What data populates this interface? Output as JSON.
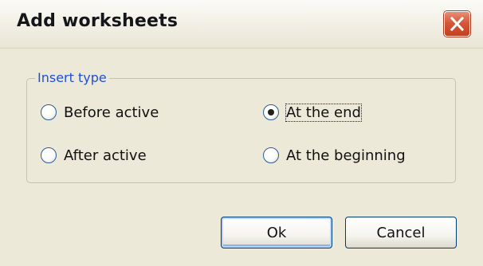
{
  "dialog": {
    "title": "Add worksheets",
    "close_icon": "close-x-icon"
  },
  "insert_type": {
    "label": "Insert type",
    "options": [
      {
        "label": "Before active",
        "selected": false
      },
      {
        "label": "At the end",
        "selected": true
      },
      {
        "label": "After active",
        "selected": false
      },
      {
        "label": "At the beginning",
        "selected": false
      }
    ]
  },
  "buttons": {
    "ok_label": "Ok",
    "cancel_label": "Cancel"
  },
  "colors": {
    "window_bg": "#ece9d8",
    "group_label": "#1f4fd8",
    "close_button": "#d5583b",
    "default_button_border": "#003c74"
  }
}
